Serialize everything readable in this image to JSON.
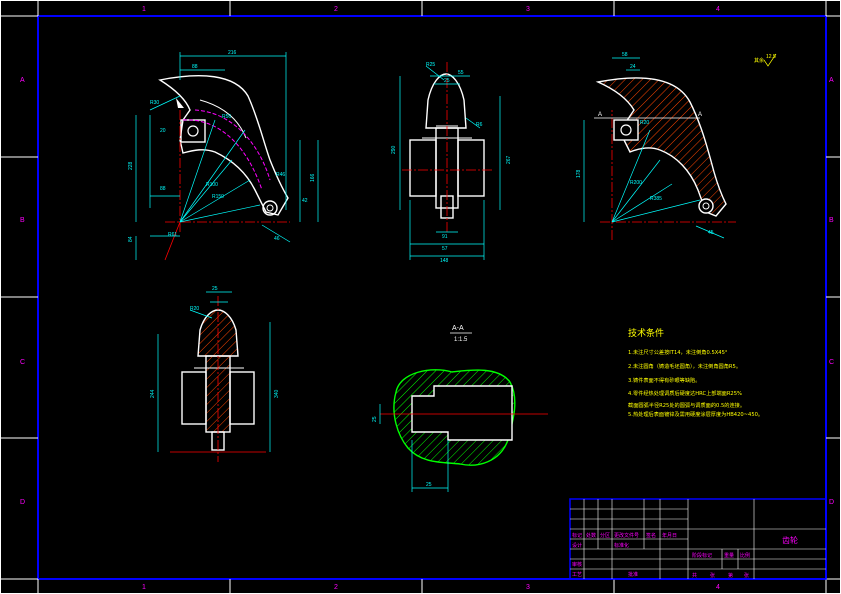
{
  "grid": {
    "columns": [
      "1",
      "2",
      "3",
      "4"
    ],
    "rows": [
      "A",
      "B",
      "C",
      "D"
    ]
  },
  "view_top_left": {
    "dims": [
      "216",
      "88",
      "228",
      "88",
      "84",
      "20",
      "166",
      "R56",
      "R100",
      "R150",
      "R46",
      "46",
      "42",
      "R30",
      "R61"
    ]
  },
  "view_front": {
    "dims": [
      "55",
      "25",
      "R25",
      "290",
      "267",
      "148",
      "57",
      "91",
      "R6"
    ]
  },
  "view_top_right": {
    "roughness": "其余",
    "roughness_value": "12.5",
    "section_mark_left": "A",
    "section_mark_right": "A",
    "dims": [
      "58",
      "24",
      "178",
      "45",
      "R20",
      "R200",
      "R385"
    ]
  },
  "view_bottom_left": {
    "dims": [
      "25",
      "R20",
      "244",
      "340"
    ]
  },
  "section": {
    "title": "A-A",
    "scale": "1:1.5",
    "dims": [
      "25",
      "25"
    ]
  },
  "notes": {
    "title": "技术条件",
    "items": [
      "1.未注尺寸公差按IT14，未注倒角0.5X45°",
      "2.未注圆角（铸造毛坯圆角），未注倒角圆角R5。",
      "3.铸件表面不得有砂眼等缺陷。",
      "4.零件经热处理调质后硬度达HRC上部端面R25%",
      "  截面圆弧半径R25处的圆弧与调质面的0.5的连接。",
      "5.热处理后表面镀锌及需用硬度涂层厚度为HB420~450。"
    ]
  },
  "title_block": {
    "part_name": "齿轮",
    "headers": [
      "标记",
      "处数",
      "分区",
      "更改文件号",
      "签名",
      "年月日"
    ],
    "row_labels": [
      "设计",
      "标准化",
      "审核",
      "工艺",
      "批准"
    ],
    "stage_labels": [
      "阶段标记",
      "重量",
      "比例"
    ],
    "sheet_labels": [
      "共",
      "张",
      "第",
      "张"
    ]
  },
  "colors": {
    "background": "#000000",
    "frame": "#0000ff",
    "outline": "#ffffff",
    "dimension": "#00ffff",
    "center": "#ff0000",
    "hidden": "#ff00ff",
    "hatch": "#ff4500",
    "section": "#00ff00",
    "notes": "#ffff00",
    "title_text": "#ff00ff"
  }
}
